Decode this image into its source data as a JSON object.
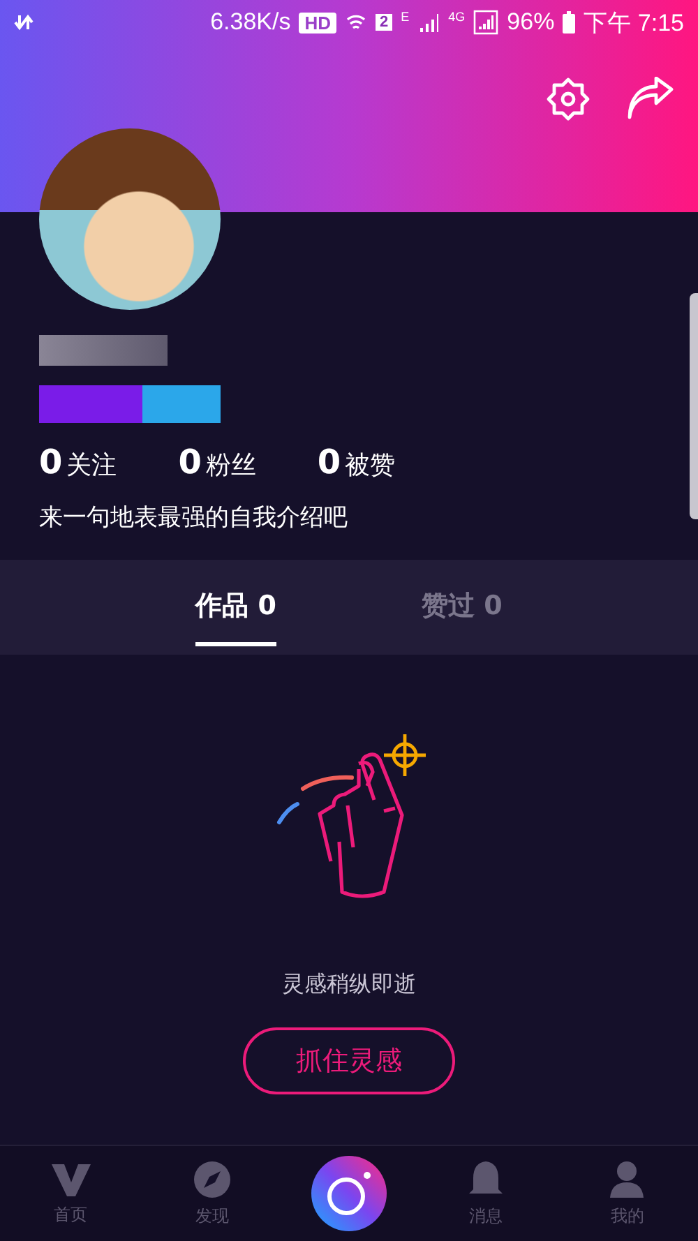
{
  "status_bar": {
    "speed": "6.38K/s",
    "hd": "HD",
    "sim": "2",
    "network_e": "E",
    "network_4g": "4G",
    "battery": "96%",
    "time": "下午 7:15"
  },
  "stats": [
    {
      "count": "0",
      "label": "关注"
    },
    {
      "count": "0",
      "label": "粉丝"
    },
    {
      "count": "0",
      "label": "被赞"
    }
  ],
  "bio": "来一句地表最强的自我介绍吧",
  "tabs": [
    {
      "label": "作品 0",
      "selected": true
    },
    {
      "label": "赞过 0",
      "selected": false
    }
  ],
  "empty_state": {
    "message": "灵感稍纵即逝",
    "button": "抓住灵感"
  },
  "bottom_nav": [
    {
      "kind": "home",
      "label": "首页"
    },
    {
      "kind": "discover",
      "label": "发现"
    },
    {
      "kind": "camera"
    },
    {
      "kind": "messages",
      "label": "消息"
    },
    {
      "kind": "profile",
      "label": "我的"
    }
  ]
}
